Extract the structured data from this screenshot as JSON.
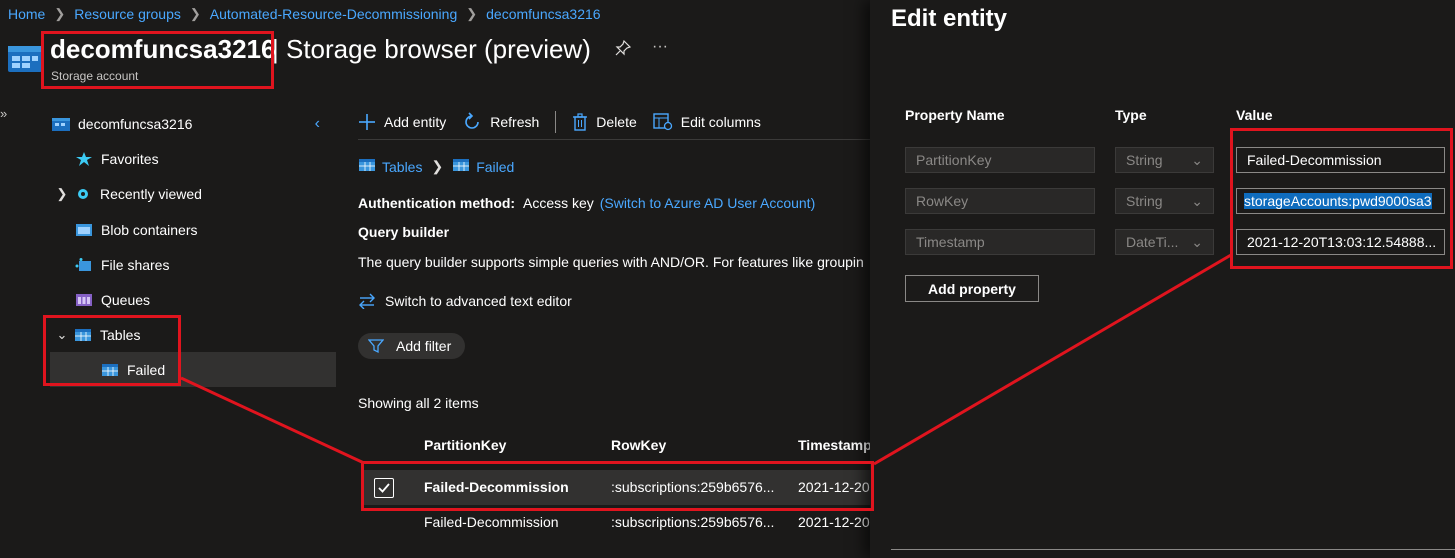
{
  "breadcrumb": [
    "Home",
    "Resource groups",
    "Automated-Resource-Decommissioning",
    "decomfuncsa3216"
  ],
  "header": {
    "resource_name": "decomfuncsa3216",
    "page_title": "| Storage browser (preview)",
    "subtitle": "Storage account",
    "pin_icon": "pin-icon",
    "more_icon": "ellipsis-icon"
  },
  "sidebar": {
    "account": "decomfuncsa3216",
    "items": [
      {
        "label": "Favorites",
        "icon": "star-icon"
      },
      {
        "label": "Recently viewed",
        "icon": "gear-icon"
      },
      {
        "label": "Blob containers",
        "icon": "blob-icon"
      },
      {
        "label": "File shares",
        "icon": "file-share-icon"
      },
      {
        "label": "Queues",
        "icon": "queue-icon"
      },
      {
        "label": "Tables",
        "icon": "table-icon"
      },
      {
        "label": "Failed",
        "icon": "table-icon"
      }
    ]
  },
  "toolbar": {
    "add_entity": "Add entity",
    "refresh": "Refresh",
    "delete": "Delete",
    "edit_columns": "Edit columns"
  },
  "path": {
    "tables": "Tables",
    "failed": "Failed"
  },
  "auth": {
    "label": "Authentication method:",
    "value": "Access key",
    "switch_link": "(Switch to Azure AD User Account)"
  },
  "query_builder": {
    "title": "Query builder",
    "description": "The query builder supports simple queries with AND/OR. For features like groupin",
    "switch_editor": "Switch to advanced text editor",
    "add_filter": "Add filter"
  },
  "grid": {
    "count_text": "Showing all 2 items",
    "columns": [
      "PartitionKey",
      "RowKey",
      "Timestamp"
    ],
    "rows": [
      {
        "partition": "Failed-Decommission",
        "row": ":subscriptions:259b6576...",
        "timestamp": "2021-12-20",
        "selected": true
      },
      {
        "partition": "Failed-Decommission",
        "row": ":subscriptions:259b6576...",
        "timestamp": "2021-12-20",
        "selected": false
      }
    ]
  },
  "edit_panel": {
    "title": "Edit entity",
    "col_property": "Property Name",
    "col_type": "Type",
    "col_value": "Value",
    "properties": [
      {
        "name": "PartitionKey",
        "type": "String",
        "value": "Failed-Decommission"
      },
      {
        "name": "RowKey",
        "type": "String",
        "value": "storageAccounts:pwd9000sa3"
      },
      {
        "name": "Timestamp",
        "type": "DateTi...",
        "value": "2021-12-20T13:03:12.54888..."
      }
    ],
    "add_property": "Add property"
  },
  "colors": {
    "background": "#1b1a19",
    "link": "#4aa8ff",
    "annotation_red": "#e0141e",
    "selection": "#0f6cbd"
  }
}
